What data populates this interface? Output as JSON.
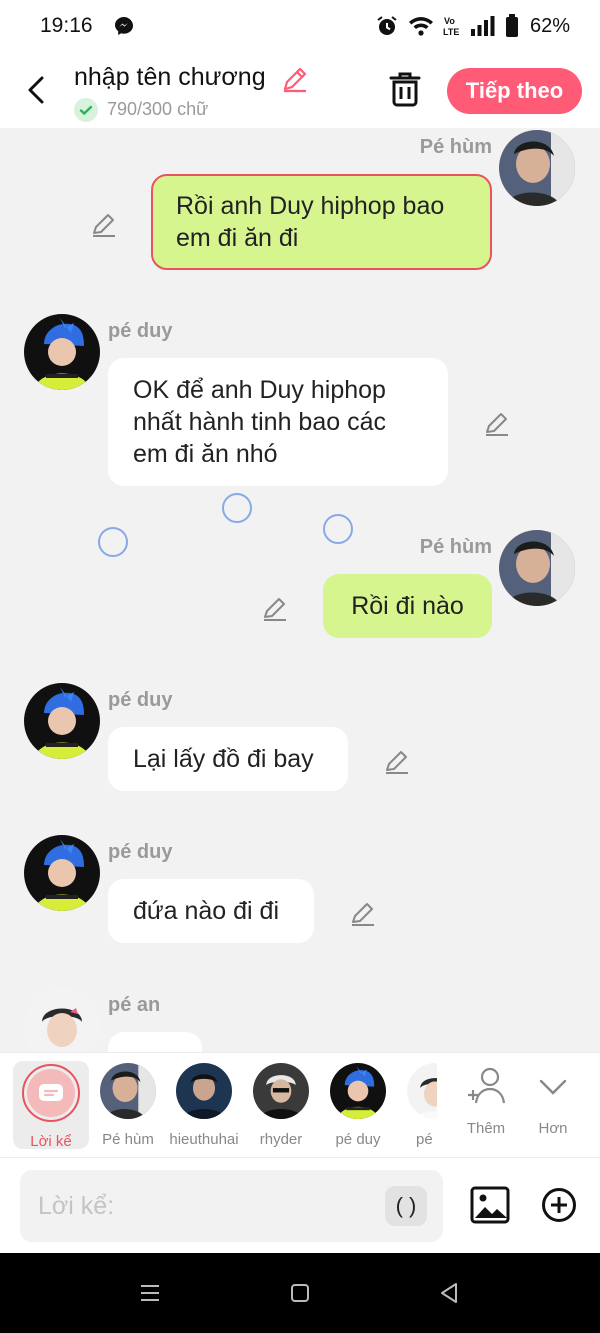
{
  "status_bar": {
    "time": "19:16",
    "battery": "62%",
    "icons": [
      "messenger-icon",
      "alarm-icon",
      "wifi-icon",
      "volte-icon",
      "signal-icon",
      "battery-icon"
    ]
  },
  "header": {
    "title": "nhập tên chương",
    "word_count": "790/300 chữ",
    "next_label": "Tiếp theo"
  },
  "messages": [
    {
      "sender": "Pé hùm",
      "text": "Rồi anh Duy hiphop bao\nem đi ăn đi",
      "side": "right",
      "selected": true
    },
    {
      "sender": "pé duy",
      "text": "OK để anh Duy hiphop\nnhất hành tinh bao các\nem đi ăn nhó",
      "side": "left"
    },
    {
      "sender": "Pé hùm",
      "text": "Rồi đi nào",
      "side": "right"
    },
    {
      "sender": "pé duy",
      "text": "Lại lấy đồ đi bay",
      "side": "left"
    },
    {
      "sender": "pé duy",
      "text": "đứa nào đi đi",
      "side": "left"
    },
    {
      "sender": "pé an",
      "text": "",
      "side": "left"
    }
  ],
  "characters": [
    {
      "label": "Lời kể",
      "active": true
    },
    {
      "label": "Pé hùm"
    },
    {
      "label": "hieuthuhai"
    },
    {
      "label": "rhyder"
    },
    {
      "label": "pé duy"
    },
    {
      "label": "pé"
    },
    {
      "label": "Thêm",
      "icon": "add-person-icon"
    },
    {
      "label": "Hơn",
      "icon": "chevron-down-icon"
    }
  ],
  "input": {
    "placeholder": "Lời kể:",
    "paren_label": "( )"
  },
  "colors": {
    "accent": "#ff5a76",
    "bubble_right": "#d6f58f",
    "bubble_left": "#ffffff",
    "selected_border": "#e8535f",
    "background": "#f2f2f2"
  }
}
